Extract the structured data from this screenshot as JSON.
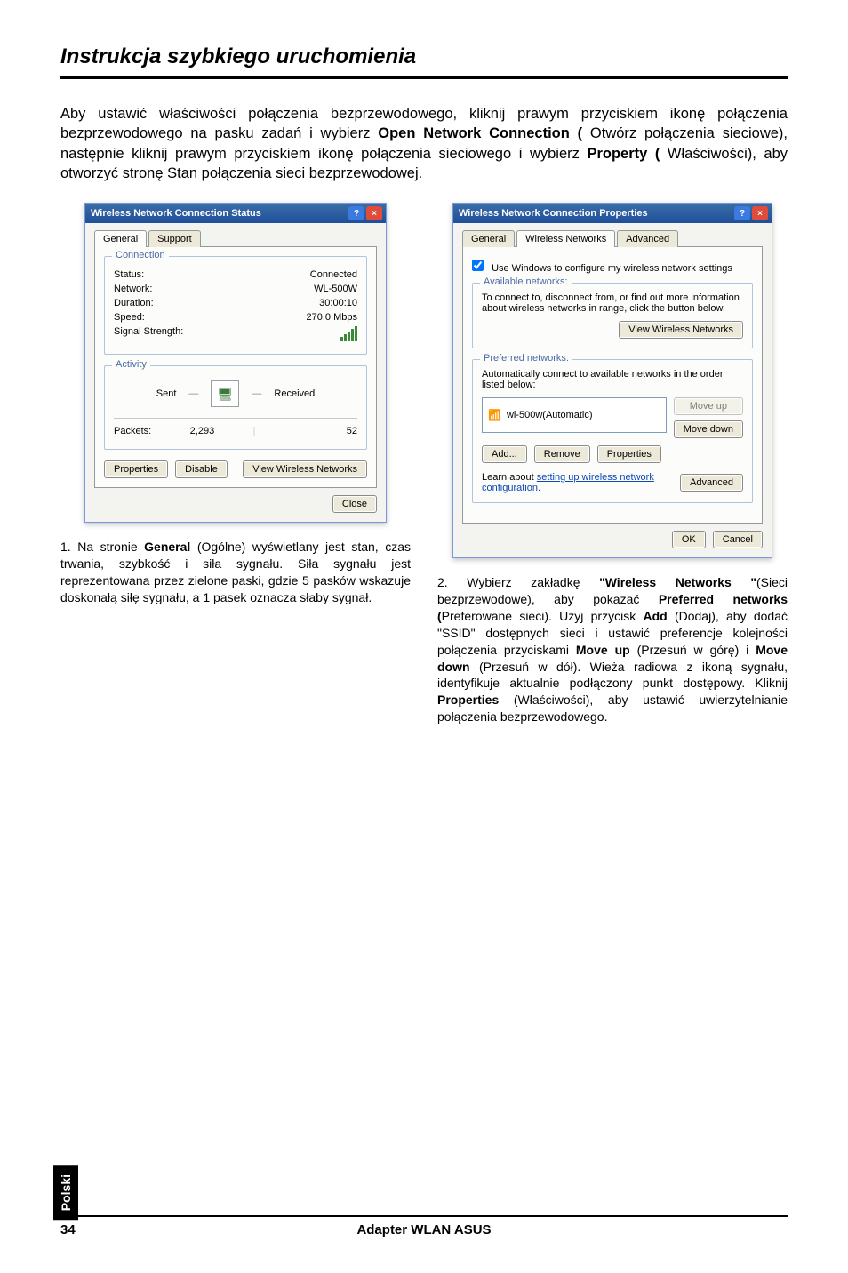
{
  "page": {
    "title": "Instrukcja szybkiego uruchomienia",
    "intro_before_open": "Aby ustawić właściwości połączenia bezprzewodowego, kliknij prawym przyciskiem ikonę połączenia bezprzewodowego na pasku zadań i wybierz ",
    "open_label": "Open Network Connection (",
    "intro_mid1": "Otwórz połączenia sieciowe), następnie kliknij prawym przyciskiem ikonę połączenia sieciowego i wybierz ",
    "property_label": "Property (",
    "intro_after": "Właściwości), aby otworzyć stronę Stan połączenia sieci bezprzewodowej.",
    "footer_title": "Adapter WLAN ASUS",
    "page_number": "34",
    "side_tab": "Polski"
  },
  "win1": {
    "title": "Wireless Network Connection Status",
    "tab_general": "General",
    "tab_support": "Support",
    "grp_connection": "Connection",
    "status_label": "Status:",
    "status_value": "Connected",
    "network_label": "Network:",
    "network_value": "WL-500W",
    "duration_label": "Duration:",
    "duration_value": "30:00:10",
    "speed_label": "Speed:",
    "speed_value": "270.0 Mbps",
    "signal_label": "Signal Strength:",
    "grp_activity": "Activity",
    "sent_label": "Sent",
    "received_label": "Received",
    "packets_label": "Packets:",
    "packets_sent": "2,293",
    "packets_recv": "52",
    "btn_properties": "Properties",
    "btn_disable": "Disable",
    "btn_view": "View Wireless Networks",
    "btn_close": "Close"
  },
  "win2": {
    "title": "Wireless Network Connection Properties",
    "tab_general": "General",
    "tab_wireless": "Wireless Networks",
    "tab_advanced": "Advanced",
    "use_windows": "Use Windows to configure my wireless network settings",
    "grp_available": "Available networks:",
    "avail_text": "To connect to, disconnect from, or find out more information about wireless networks in range, click the button below.",
    "btn_view_wn": "View Wireless Networks",
    "grp_preferred": "Preferred networks:",
    "pref_text": "Automatically connect to available networks in the order listed below:",
    "list_item": "wl-500w(Automatic)",
    "btn_moveup": "Move up",
    "btn_movedown": "Move down",
    "btn_add": "Add...",
    "btn_remove": "Remove",
    "btn_properties": "Properties",
    "learn_text": "Learn about ",
    "learn_link": "setting up wireless network configuration.",
    "btn_advanced": "Advanced",
    "btn_ok": "OK",
    "btn_cancel": "Cancel"
  },
  "captions": {
    "c1_num": "1. ",
    "c1_prefix": "Na stronie ",
    "c1_bold": "General",
    "c1_rest": " (Ogólne) wyświetlany jest stan, czas trwania, szybkość i siła sygnału. Siła sygnału jest reprezentowana przez zielone paski, gdzie 5 pasków wskazuje doskonałą siłę sygnału, a 1 pasek oznacza słaby sygnał.",
    "c2_num": "2. ",
    "c2_t1": "Wybierz zakładkę ",
    "c2_b1": "\"Wireless Networks \"",
    "c2_t2": "(Sieci bezprzewodowe), aby pokazać ",
    "c2_b2": "Preferred networks  (",
    "c2_t3": "Preferowane sieci). Użyj przycisk ",
    "c2_b3": "Add",
    "c2_t4": " (Dodaj), aby dodać \"SSID\" dostępnych sieci i ustawić preferencje kolejności połączenia przyciskami ",
    "c2_b4": "Move up",
    "c2_t5": " (Przesuń w górę) i ",
    "c2_b5": "Move down",
    "c2_t6": " (Przesuń w dół). Wieża radiowa z ikoną sygnału, identyfikuje aktualnie podłączony punkt dostępowy. Kliknij ",
    "c2_b6": "Properties",
    "c2_t7": " (Właściwości), aby ustawić uwierzytelnianie połączenia bezprzewodowego."
  }
}
